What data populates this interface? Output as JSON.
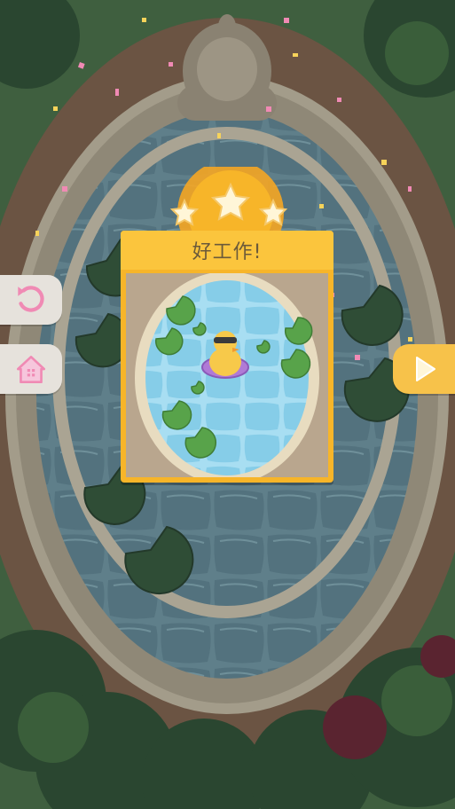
{
  "level_complete": {
    "title": "好工作!",
    "stars_earned": 3,
    "stars_total": 3
  },
  "buttons": {
    "replay_icon": "replay-icon",
    "home_icon": "home-icon",
    "next_icon": "play-arrow-icon"
  },
  "colors": {
    "card": "#f7b529",
    "card_header": "#fbc53d",
    "star": "#fff6d8",
    "accent_pink": "#f08ab4",
    "next_button": "#f7c24a"
  }
}
